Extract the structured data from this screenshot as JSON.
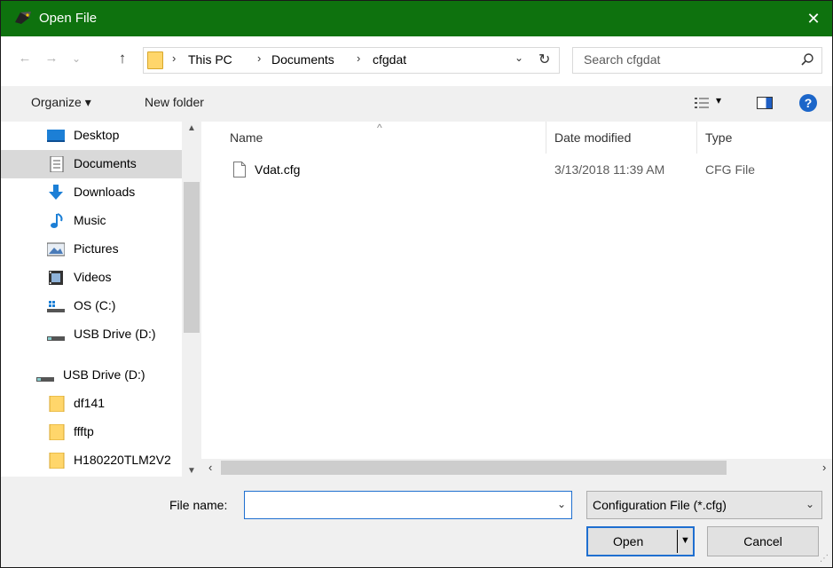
{
  "window": {
    "title": "Open File",
    "close_glyph": "✕",
    "titlebar_color": "#0e720e"
  },
  "nav": {
    "back_glyph": "←",
    "forward_glyph": "→",
    "recent_glyph": "⌄",
    "up_glyph": "↑",
    "breadcrumb": [
      "This PC",
      "Documents",
      "cfgdat"
    ],
    "separator": "›",
    "dropdown_glyph": "⌄",
    "refresh_glyph": "↻"
  },
  "search": {
    "placeholder": "Search cfgdat",
    "icon": "search-icon"
  },
  "toolbar": {
    "organize": "Organize ▾",
    "new_folder": "New folder",
    "view_dd": "▾",
    "help": "?"
  },
  "sidebar": {
    "items": [
      {
        "label": "Desktop",
        "icon": "desktop-icon"
      },
      {
        "label": "Documents",
        "icon": "documents-icon",
        "selected": true
      },
      {
        "label": "Downloads",
        "icon": "downloads-icon"
      },
      {
        "label": "Music",
        "icon": "music-icon"
      },
      {
        "label": "Pictures",
        "icon": "pictures-icon"
      },
      {
        "label": "Videos",
        "icon": "videos-icon"
      },
      {
        "label": "OS (C:)",
        "icon": "drive-c-icon"
      },
      {
        "label": "USB Drive (D:)",
        "icon": "usb-drive-icon"
      },
      {
        "label": "USB Drive (D:)",
        "icon": "usb-drive-icon"
      },
      {
        "label": "df141",
        "icon": "folder-icon"
      },
      {
        "label": "ffftp",
        "icon": "folder-icon"
      },
      {
        "label": "H180220TLM2V2",
        "icon": "folder-icon"
      }
    ],
    "scroll_up": "▲",
    "scroll_down": "▼"
  },
  "filelist": {
    "columns": [
      "Name",
      "Date modified",
      "Type"
    ],
    "sort_glyph": "^",
    "rows": [
      {
        "name": "Vdat.cfg",
        "date": "3/13/2018 11:39 AM",
        "type": "CFG File"
      }
    ],
    "scroll_left": "‹",
    "scroll_right": "›"
  },
  "bottom": {
    "file_name_label": "File name:",
    "file_name_value": "",
    "file_type": "Configuration File (*.cfg)",
    "dd_glyph": "⌄",
    "open": "Open",
    "open_arrow": "▼",
    "cancel": "Cancel"
  }
}
